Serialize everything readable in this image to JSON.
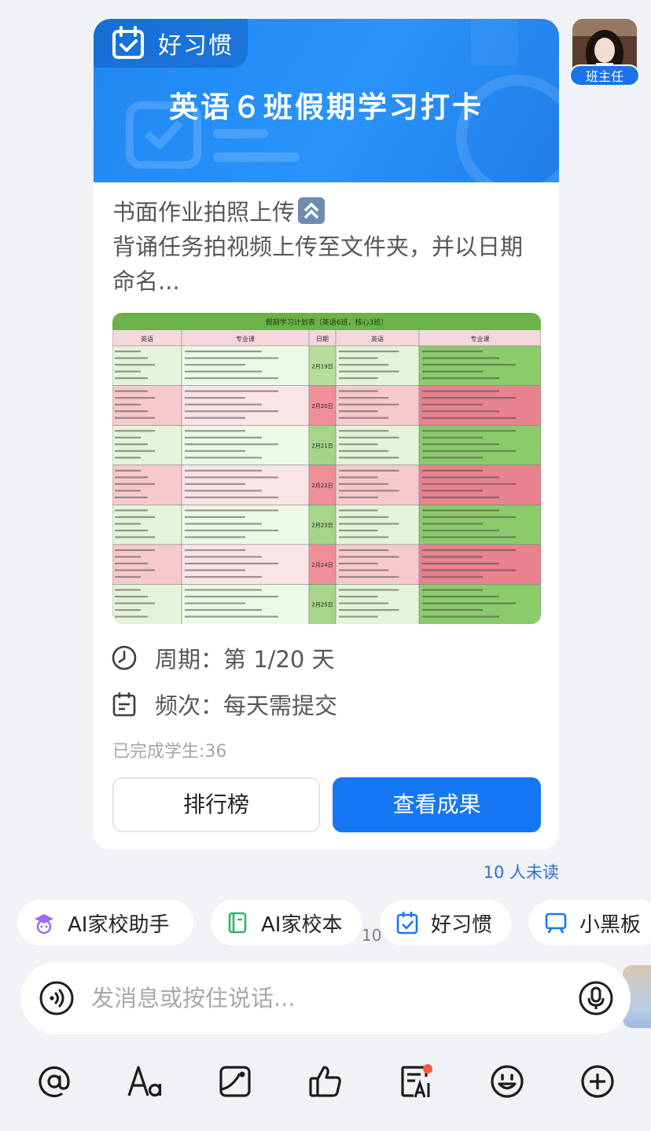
{
  "avatar": {
    "badge": "班主任"
  },
  "card": {
    "tag": "好习惯",
    "title": "英语６班假期学习打卡",
    "desc_line1": "书面作业拍照上传",
    "desc_line2": "背诵任务拍视频上传至文件夹，并以日期命名...",
    "period_label": "周期：",
    "period_value": "第 1/20 天",
    "freq_label": "频次：",
    "freq_value": "每天需提交",
    "completed": "已完成学生:36",
    "rank_button": "排行榜",
    "result_button": "查看成果"
  },
  "schedule_image": {
    "title": "假期学习计划表（英语6班，核心3班）",
    "headers": [
      "英语",
      "专业课",
      "日期",
      "英语",
      "专业课"
    ],
    "dates": [
      "2月19日",
      "2月20日",
      "2月21日",
      "2月22日",
      "2月23日",
      "2月24日",
      "2月25日"
    ]
  },
  "unread": "10 人未读",
  "chips": [
    {
      "label": "AI家校助手",
      "icon": "ai-assistant-icon"
    },
    {
      "label": "AI家校本",
      "icon": "notebook-icon"
    },
    {
      "label": "好习惯",
      "icon": "calendar-check-icon"
    },
    {
      "label": "小黑板",
      "icon": "blackboard-icon"
    }
  ],
  "chip_count": "10",
  "input": {
    "placeholder": "发消息或按住说话..."
  },
  "colors": {
    "primary": "#1677f5",
    "banner": "#2a93fb",
    "background": "#f1f2f5"
  }
}
